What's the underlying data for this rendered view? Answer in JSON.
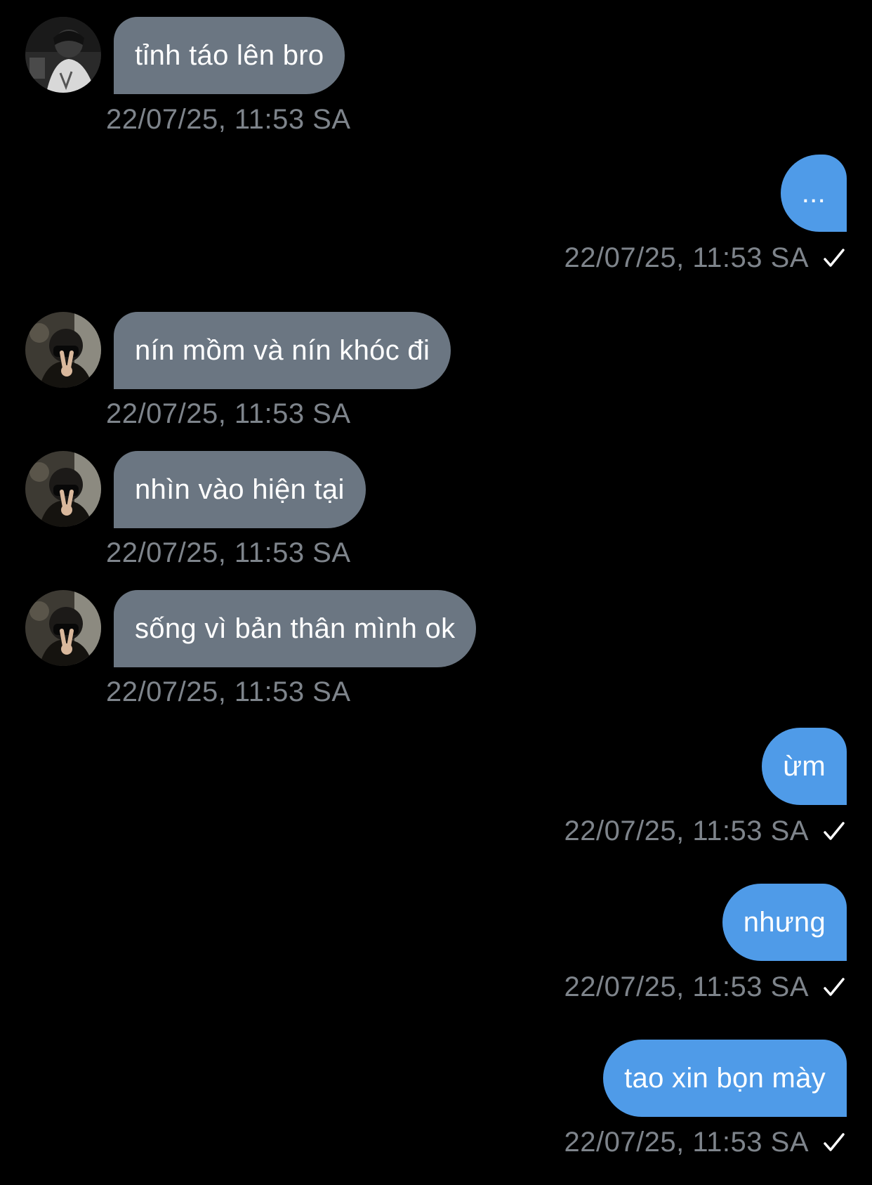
{
  "messages": [
    {
      "direction": "in",
      "avatar_style": "bw",
      "text": "tỉnh táo lên bro",
      "time": "22/07/25, 11:53 SA"
    },
    {
      "direction": "out",
      "text": "...",
      "time": "22/07/25, 11:53 SA",
      "status_icon": "check-icon"
    },
    {
      "direction": "in",
      "avatar_style": "color",
      "text": "nín mồm và nín khóc đi",
      "time": "22/07/25, 11:53 SA"
    },
    {
      "direction": "in",
      "avatar_style": "color",
      "text": "nhìn vào hiện tại",
      "time": "22/07/25, 11:53 SA"
    },
    {
      "direction": "in",
      "avatar_style": "color",
      "text": "sống vì bản thân mình ok",
      "time": "22/07/25, 11:53 SA"
    },
    {
      "direction": "out",
      "text": "ừm",
      "time": "22/07/25, 11:53 SA",
      "status_icon": "check-icon"
    },
    {
      "direction": "out",
      "text": "nhưng",
      "time": "22/07/25, 11:53 SA",
      "status_icon": "check-icon"
    },
    {
      "direction": "out",
      "text": "tao xin bọn mày",
      "time": "22/07/25, 11:53 SA",
      "status_icon": "check-icon"
    }
  ],
  "colors": {
    "background": "#000000",
    "incoming_bubble": "#6b7682",
    "outgoing_bubble": "#4f9be8",
    "timestamp": "#7e848b",
    "text": "#ffffff"
  }
}
